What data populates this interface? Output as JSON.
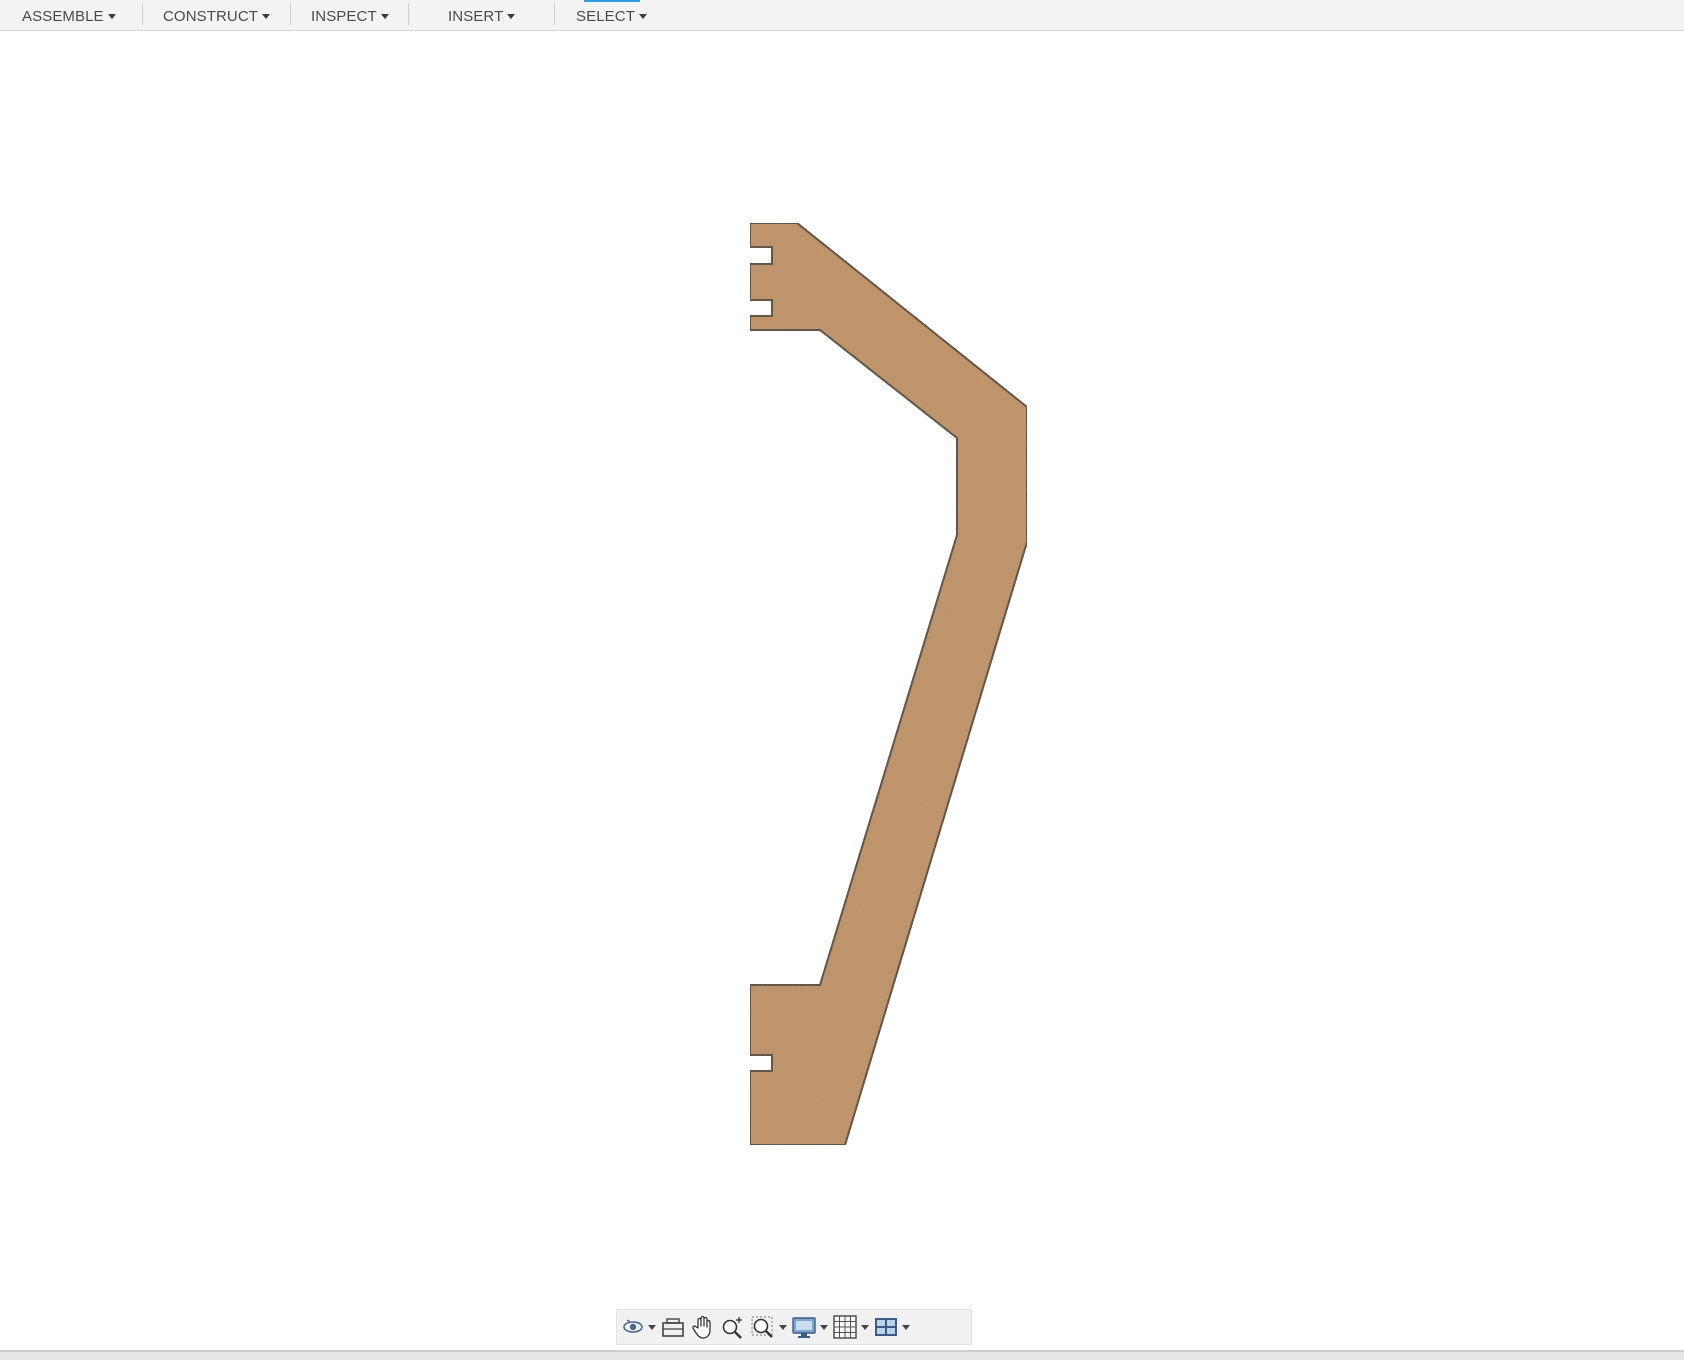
{
  "toolbar": {
    "menus": [
      {
        "label": "ASSEMBLE"
      },
      {
        "label": "CONSTRUCT"
      },
      {
        "label": "INSPECT"
      },
      {
        "label": "INSERT"
      },
      {
        "label": "SELECT"
      }
    ]
  },
  "viewport": {
    "material_color": "#c99a6e",
    "outline_color": "#3a3a3a"
  },
  "navbar": {
    "tools": [
      {
        "icon": "orbit-icon",
        "has_dropdown": true
      },
      {
        "icon": "look-at-icon",
        "has_dropdown": false
      },
      {
        "icon": "pan-hand-icon",
        "has_dropdown": false
      },
      {
        "icon": "zoom-icon",
        "has_dropdown": false
      },
      {
        "icon": "zoom-window-icon",
        "has_dropdown": true
      },
      {
        "icon": "display-settings-icon",
        "has_dropdown": true
      },
      {
        "icon": "grid-icon",
        "has_dropdown": true
      },
      {
        "icon": "viewports-icon",
        "has_dropdown": true
      }
    ]
  },
  "colors": {
    "accent": "#2f9be0",
    "toolbar_bg": "#f3f3f3"
  }
}
